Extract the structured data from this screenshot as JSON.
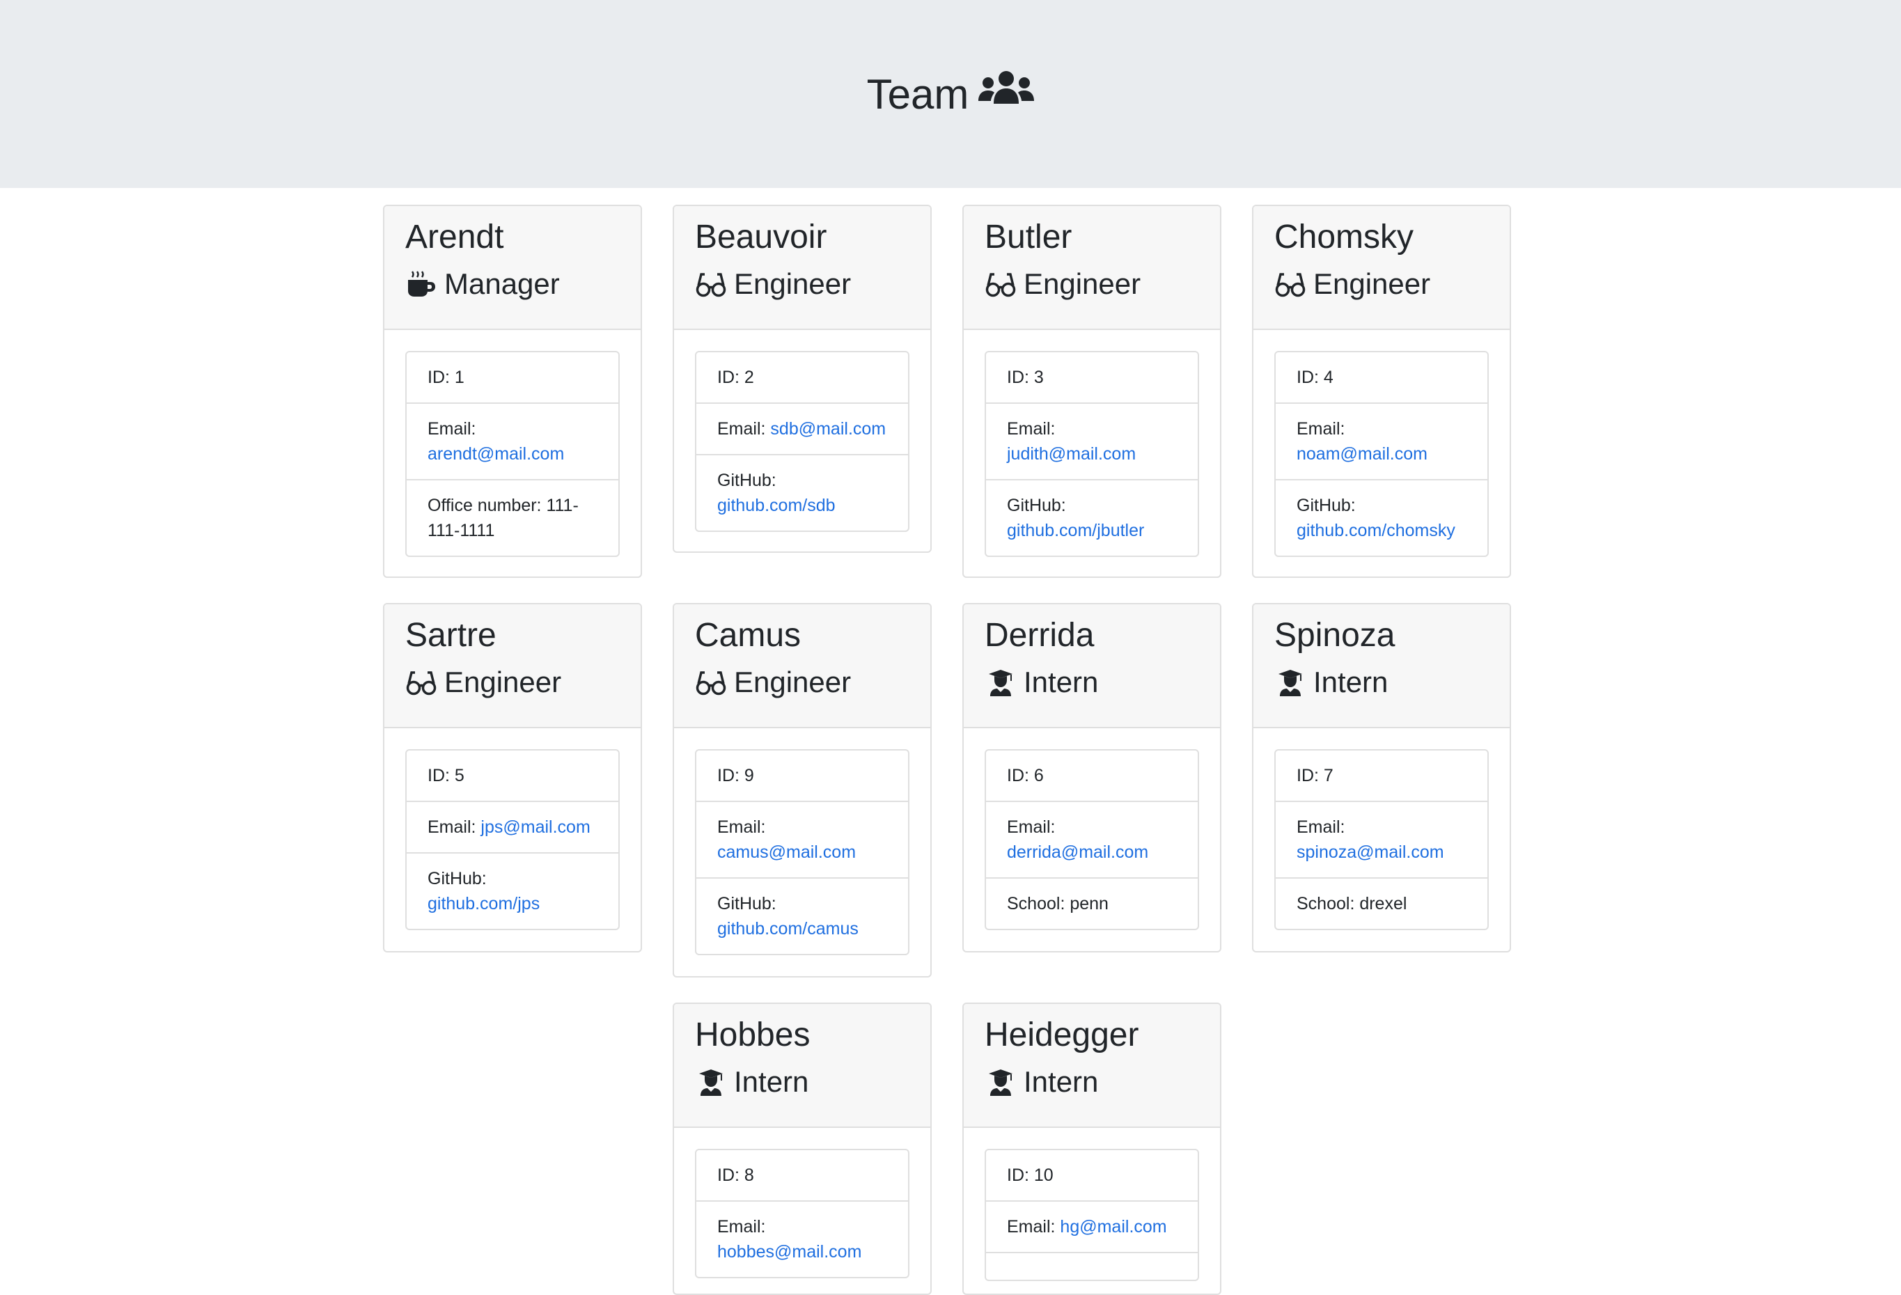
{
  "header": {
    "title": "Team",
    "icon": "users-icon"
  },
  "employees": [
    {
      "name": "Arendt",
      "role": "Manager",
      "icon": "coffee-icon",
      "id_label": "ID: 1",
      "email_label": "Email:",
      "email": "arendt@mail.com",
      "extra_label": "Office number: 111-111-1111",
      "extra_value": ""
    },
    {
      "name": "Beauvoir",
      "role": "Engineer",
      "icon": "glasses-icon",
      "id_label": "ID: 2",
      "email_label": "Email:",
      "email": "sdb@mail.com",
      "extra_label": "GitHub:",
      "extra_value": "github.com/sdb"
    },
    {
      "name": "Butler",
      "role": "Engineer",
      "icon": "glasses-icon",
      "id_label": "ID: 3",
      "email_label": "Email:",
      "email": "judith@mail.com",
      "extra_label": "GitHub:",
      "extra_value": "github.com/jbutler"
    },
    {
      "name": "Chomsky",
      "role": "Engineer",
      "icon": "glasses-icon",
      "id_label": "ID: 4",
      "email_label": "Email:",
      "email": "noam@mail.com",
      "extra_label": "GitHub:",
      "extra_value": "github.com/chomsky"
    },
    {
      "name": "Sartre",
      "role": "Engineer",
      "icon": "glasses-icon",
      "id_label": "ID: 5",
      "email_label": "Email:",
      "email": "jps@mail.com",
      "extra_label": "GitHub:",
      "extra_value": "github.com/jps"
    },
    {
      "name": "Camus",
      "role": "Engineer",
      "icon": "glasses-icon",
      "id_label": "ID: 9",
      "email_label": "Email:",
      "email": "camus@mail.com",
      "extra_label": "GitHub:",
      "extra_value": "github.com/camus"
    },
    {
      "name": "Derrida",
      "role": "Intern",
      "icon": "graduate-icon",
      "id_label": "ID: 6",
      "email_label": "Email:",
      "email": "derrida@mail.com",
      "extra_label": "School: penn",
      "extra_value": ""
    },
    {
      "name": "Spinoza",
      "role": "Intern",
      "icon": "graduate-icon",
      "id_label": "ID: 7",
      "email_label": "Email:",
      "email": "spinoza@mail.com",
      "extra_label": "School: drexel",
      "extra_value": ""
    },
    {
      "name": "Hobbes",
      "role": "Intern",
      "icon": "graduate-icon",
      "id_label": "ID: 8",
      "email_label": "Email:",
      "email": "hobbes@mail.com",
      "extra_label": "",
      "extra_value": ""
    },
    {
      "name": "Heidegger",
      "role": "Intern",
      "icon": "graduate-icon",
      "id_label": "ID: 10",
      "email_label": "Email:",
      "email": "hg@mail.com",
      "extra_label": "",
      "extra_value": ""
    }
  ],
  "colors": {
    "jumbotron": "#e9ecef",
    "link": "#1f6fe0",
    "header_bg": "#f7f7f7",
    "border": "#dfdfdf"
  }
}
